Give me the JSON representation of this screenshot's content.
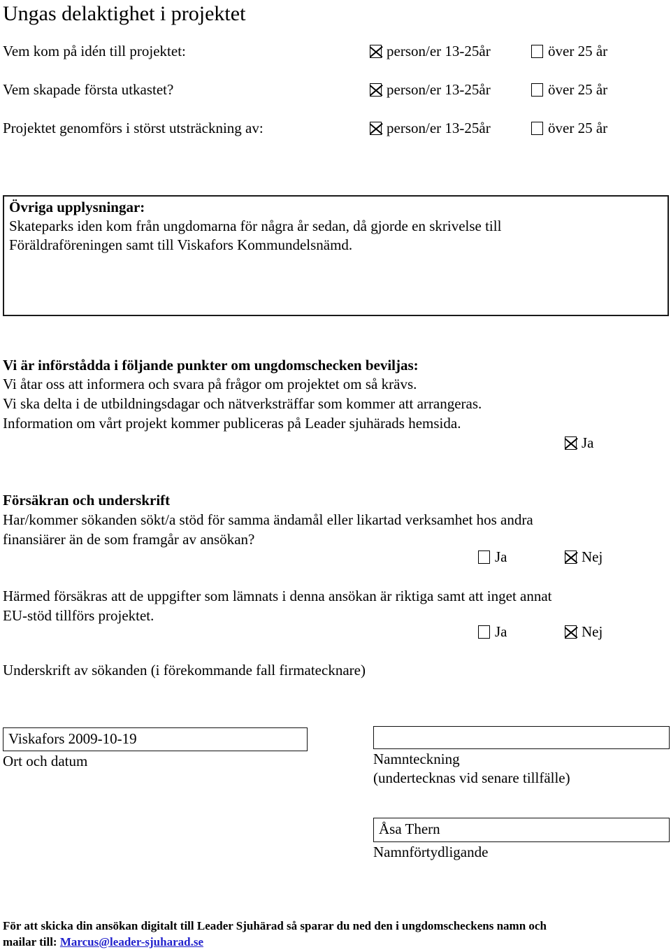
{
  "document": {
    "title": "Ungas delaktighet i projektet"
  },
  "participation": {
    "option_young_label": "person/er 13-25år",
    "option_old_label": "över 25 år",
    "rows": [
      {
        "question": "Vem kom på idén till projektet:",
        "young_checked": true,
        "old_checked": false
      },
      {
        "question": "Vem skapade första utkastet?",
        "young_checked": true,
        "old_checked": false
      },
      {
        "question": "Projektet genomförs i störst utsträckning av:",
        "young_checked": true,
        "old_checked": false
      }
    ]
  },
  "notes": {
    "heading": "Övriga upplysningar:",
    "line1": "Skateparks iden kom från ungdomarna för några år sedan, då gjorde en skrivelse till",
    "line2": "Föräldraföreningen samt till Viskafors Kommundelsnämd."
  },
  "terms": {
    "heading": "Vi är införstådda i följande punkter om ungdomschecken beviljas:",
    "line1": "Vi åtar oss att informera och svara på frågor om projektet om så krävs.",
    "line2": "Vi ska delta i de utbildningsdagar och nätverksträffar som kommer att arrangeras.",
    "line3": "Information om vårt projekt kommer publiceras på Leader sjuhärads hemsida.",
    "agree_label": "Ja",
    "agree_checked": true
  },
  "declaration": {
    "heading": "Försäkran och underskrift",
    "question_line1": "Har/kommer sökanden sökt/a stöd för samma ändamål eller likartad verksamhet hos andra",
    "question_line2": "finansiärer än de som framgår av ansökan?",
    "q1_ja_label": "Ja",
    "q1_nej_label": "Nej",
    "q1_ja_checked": false,
    "q1_nej_checked": true,
    "statement_line1": "Härmed försäkras att de uppgifter som lämnats i denna ansökan är riktiga samt att inget annat",
    "statement_line2": "EU-stöd tillförs projektet.",
    "q2_ja_label": "Ja",
    "q2_nej_label": "Nej",
    "q2_ja_checked": false,
    "q2_nej_checked": true
  },
  "signature": {
    "caption": "Underskrift av sökanden (i förekommande fall firmatecknare)",
    "date_value": "Viskafors 2009-10-19",
    "date_caption": "Ort och datum",
    "signature_value": "",
    "signature_caption": "Namnteckning",
    "signature_subcaption": "(undertecknas vid senare tillfälle)",
    "name_value": "Åsa Thern",
    "name_caption": "Namnförtydligande"
  },
  "footer": {
    "line1": "För att skicka din ansökan digitalt till Leader Sjuhärad så sparar du ned den i ungdomscheckens namn och",
    "line2_prefix": "mailar till: ",
    "email": "Marcus@leader-sjuharad.se",
    "link_color": "#2222cc"
  }
}
